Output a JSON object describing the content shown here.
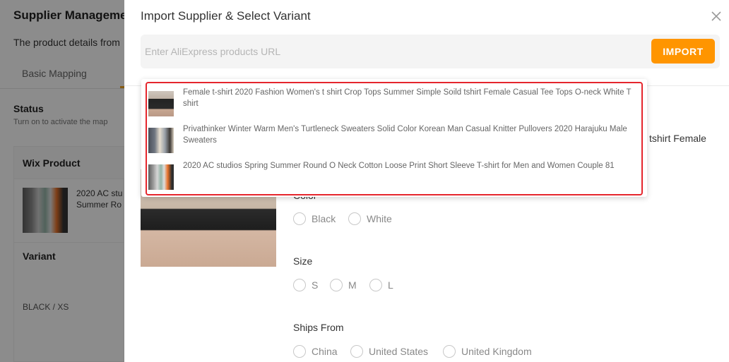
{
  "background": {
    "page_title": "Supplier Manageme",
    "description": "The product details from",
    "tab": "Basic Mapping",
    "status_title": "Status",
    "status_sub": "Turn on to activate the map",
    "wix_product_header": "Wix Product",
    "product_name_line1": "2020 AC stu",
    "product_name_line2": "Summer Ro",
    "variant_header": "Variant",
    "variant_value": "BLACK / XS"
  },
  "drawer": {
    "title": "Import Supplier & Select Variant",
    "close_icon": "close-icon",
    "url_input_value": "",
    "url_placeholder": "Enter AliExpress products URL",
    "import_label": "IMPORT",
    "hidden_title_tail": "tshirt Female"
  },
  "suggestions": [
    {
      "text": "Female t-shirt 2020 Fashion Women's t shirt Crop Tops Summer Simple Soild tshirt Female Casual Tee Tops O-neck White T shirt",
      "icon": "product-thumbnail"
    },
    {
      "text": "Privathinker Winter Warm Men's Turtleneck Sweaters Solid Color Korean Man Casual Knitter Pullovers 2020 Harajuku Male Sweaters",
      "icon": "product-thumbnail"
    },
    {
      "text": "2020 AC studios Spring Summer Round O Neck Cotton Loose Print Short Sleeve T-shirt for Men and Women Couple 81",
      "icon": "product-thumbnail"
    }
  ],
  "options": {
    "color_label": "Color",
    "colors": [
      "Black",
      "White"
    ],
    "size_label": "Size",
    "sizes": [
      "S",
      "M",
      "L"
    ],
    "ships_label": "Ships From",
    "ships": [
      "China",
      "United States",
      "United Kingdom"
    ]
  },
  "colors": {
    "accent": "#ff9500",
    "highlight_border": "#e5262d"
  }
}
